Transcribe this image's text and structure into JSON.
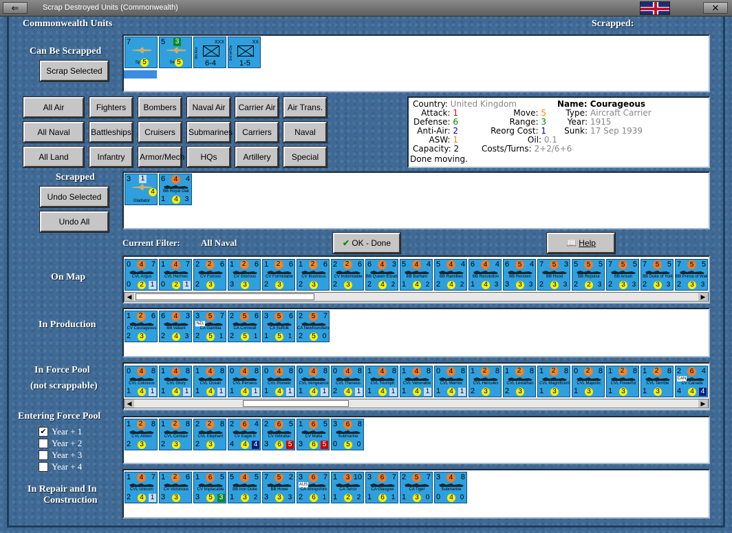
{
  "window": {
    "title": "Scrap Destroyed Units (Commonwealth)"
  },
  "header": {
    "left": "Commonwealth Units",
    "right": "Scrapped:"
  },
  "scrappable": {
    "label": "Can Be Scrapped",
    "button": "Scrap Selected",
    "units": [
      {
        "tl": "7",
        "tr": "",
        "br": "",
        "type": "plane",
        "name": "Spitfire",
        "yel": "5",
        "orange": "",
        "sq": "",
        "sqc": ""
      },
      {
        "tl": "5",
        "tr": "",
        "type": "plane",
        "name": "Seafire",
        "yel": "5",
        "bl": "",
        "badge": "3"
      },
      {
        "tl": "",
        "tr": "XXX",
        "type": "inf",
        "name": "6-4",
        "side": "6th Arm"
      },
      {
        "tl": "",
        "tr": "XX",
        "type": "inf",
        "name": "1-5",
        "side": "3rd Inf Div"
      }
    ]
  },
  "filters": {
    "row1": [
      "All Air",
      "Fighters",
      "Bombers",
      "Naval Air",
      "Carrier Air",
      "Air Trans."
    ],
    "row2": [
      "All Naval",
      "Battleships",
      "Cruisers",
      "Submarines",
      "Carriers",
      "Naval Trans."
    ],
    "row3": [
      "All Land",
      "Infantry",
      "Armor/Mech",
      "HQs",
      "Artillery",
      "Special"
    ]
  },
  "info": {
    "country_k": "Country:",
    "country_v": "United Kingdom",
    "attack_k": "Attack:",
    "attack_v": "1",
    "defense_k": "Defense:",
    "defense_v": "6",
    "antiair_k": "Anti-Air:",
    "antiair_v": "2",
    "asw_k": "ASW:",
    "asw_v": "1",
    "capacity_k": "Capacity:",
    "capacity_v": "2",
    "status": "Done moving.",
    "move_k": "Move:",
    "move_v": "5",
    "range_k": "Range:",
    "range_v": "3",
    "reorg_k": "Reorg Cost:",
    "reorg_v": "1",
    "oil_k": "Oil:",
    "oil_v": "0.1",
    "cost_k": "Costs/Turns:",
    "cost_v": "2+2/6+6",
    "name_k": "Name:",
    "name_v": "Courageous",
    "type_k": "Type:",
    "type_v": "Aircraft Carrier",
    "year_k": "Year:",
    "year_v": "1915",
    "sunk_k": "Sunk:",
    "sunk_v": "17 Sep 1939"
  },
  "scrapped": {
    "label": "Scrapped",
    "undo_selected": "Undo Selected",
    "undo_all": "Undo All",
    "units": [
      {
        "tl": "3",
        "tr": "",
        "badge": "1",
        "type": "plane",
        "name": "Gladiator",
        "yel": "4"
      },
      {
        "tl": "6",
        "tr": "4",
        "o": "4",
        "type": "ship",
        "name": "BB Royal Oak",
        "bl": "1",
        "yel": "4",
        "br": "3"
      }
    ]
  },
  "filter_bar": {
    "label": "Current Filter:",
    "value": "All Naval",
    "ok": "OK - Done",
    "help": "Help"
  },
  "sections": {
    "on_map": "On Map",
    "in_production": "In Production",
    "force_pool_1": "In Force Pool",
    "force_pool_2": "(not scrappable)",
    "entering": "Entering Force Pool",
    "repair_1": "In Repair and In",
    "repair_2": "Construction"
  },
  "years": [
    {
      "label": "Year + 1",
      "checked": true
    },
    {
      "label": "Year + 2",
      "checked": false
    },
    {
      "label": "Year + 3",
      "checked": false
    },
    {
      "label": "Year + 4",
      "checked": false
    }
  ],
  "on_map": [
    {
      "tl": "0",
      "o": "4",
      "tr": "7",
      "name": "CVL Argus",
      "bl": "0",
      "yel": "2",
      "sq": "1",
      "sqc": "b"
    },
    {
      "tl": "1",
      "o": "4",
      "tr": "7",
      "name": "CVL Hermes",
      "bl": "0",
      "yel": "2",
      "sq": "1",
      "sqc": "b"
    },
    {
      "tl": "2",
      "o": "5",
      "tr": "6",
      "name": "CV Furious",
      "bl": "2",
      "yel": "3",
      "sq": "2",
      "sqc": "o"
    },
    {
      "tl": "1",
      "o": "5",
      "tr": "6",
      "name": "CV Glorious",
      "bl": "3",
      "yel": "3",
      "sq": "2",
      "sqc": "o"
    },
    {
      "tl": "1",
      "o": "5",
      "tr": "6",
      "name": "CV Formidable",
      "bl": "2",
      "yel": "3",
      "sq": "2",
      "sqc": "o"
    },
    {
      "tl": "1",
      "o": "5",
      "tr": "6",
      "name": "CV Illustrious",
      "bl": "2",
      "yel": "3",
      "sq": "2",
      "sqc": "o"
    },
    {
      "tl": "2",
      "o": "5",
      "tr": "6",
      "name": "CV Indomitable",
      "bl": "2",
      "yel": "3",
      "sq": "2",
      "sqc": "o"
    },
    {
      "tl": "6",
      "o": "4",
      "tr": "3",
      "name": "BB Queen Elizabeth",
      "bl": "2",
      "yel": "4",
      "sq": "2",
      "sqc": ""
    },
    {
      "tl": "5",
      "o": "4",
      "tr": "4",
      "name": "BB Barham",
      "bl": "1",
      "yel": "4",
      "sq": "2",
      "sqc": ""
    },
    {
      "tl": "5",
      "o": "4",
      "tr": "4",
      "name": "BB Ramillies",
      "bl": "2",
      "yel": "4",
      "sq": "2",
      "sqc": ""
    },
    {
      "tl": "6",
      "o": "4",
      "tr": "4",
      "name": "BB Resolution",
      "bl": "1",
      "yel": "4",
      "sq": "3",
      "sqc": ""
    },
    {
      "tl": "6",
      "o": "5",
      "tr": "4",
      "name": "BB Renown",
      "bl": "3",
      "yel": "3",
      "sq": "3",
      "sqc": ""
    },
    {
      "tl": "7",
      "o": "5",
      "tr": "3",
      "name": "BB Hood",
      "bl": "2",
      "yel": "3",
      "sq": "3",
      "sqc": ""
    },
    {
      "tl": "5",
      "o": "5",
      "tr": "5",
      "name": "BB Repulse",
      "bl": "2",
      "yel": "2",
      "sq": "3",
      "sqc": ""
    },
    {
      "tl": "7",
      "o": "5",
      "tr": "5",
      "name": "BB Anson",
      "bl": "2",
      "yel": "3",
      "sq": "3",
      "sqc": ""
    },
    {
      "tl": "7",
      "o": "5",
      "tr": "5",
      "name": "BB Duke of York",
      "bl": "2",
      "yel": "3",
      "sq": "3",
      "sqc": ""
    },
    {
      "tl": "7",
      "o": "5",
      "tr": "5",
      "name": "BB Prince of Wales",
      "bl": "2",
      "yel": "3",
      "sq": "3",
      "sqc": ""
    }
  ],
  "in_production": [
    {
      "tl": "1",
      "o": "5",
      "tr": "6",
      "name": "CV Courageous",
      "bl": "2",
      "yel": "3",
      "sq": "2",
      "sqc": "o"
    },
    {
      "tl": "6",
      "o": "4",
      "tr": "3",
      "name": "BB Valiant",
      "bl": "2",
      "yel": "4",
      "sq": "3",
      "sqc": ""
    },
    {
      "tl": "3",
      "o": "5",
      "tr": "7",
      "name": "CA Gambia",
      "bl": "2",
      "yel": "5",
      "sq": "1",
      "sqc": "",
      "flag": "NZL"
    },
    {
      "tl": "2",
      "o": "5",
      "tr": "6",
      "name": "CA Cornwall",
      "bl": "2",
      "yel": "5",
      "sq": "1",
      "sqc": ""
    },
    {
      "tl": "3",
      "o": "5",
      "tr": "6",
      "name": "CA Suffolk",
      "bl": "1",
      "yel": "5",
      "sq": "1",
      "sqc": ""
    },
    {
      "tl": "2",
      "o": "5",
      "tr": "7",
      "name": "CA Newfoundland",
      "bl": "2",
      "yel": "5",
      "sq": "0",
      "sqc": ""
    }
  ],
  "force_pool": [
    {
      "tl": "0",
      "o": "4",
      "tr": "8",
      "name": "CVL Colossus",
      "bl": "1",
      "yel": "4",
      "sq": "1",
      "sqc": "b"
    },
    {
      "tl": "1",
      "o": "4",
      "tr": "8",
      "name": "CVL Glory",
      "bl": "1",
      "yel": "4",
      "sq": "1",
      "sqc": "b"
    },
    {
      "tl": "1",
      "o": "4",
      "tr": "8",
      "name": "CVL Ocean",
      "bl": "1",
      "yel": "4",
      "sq": "1",
      "sqc": "b"
    },
    {
      "tl": "0",
      "o": "4",
      "tr": "8",
      "name": "CVL Perseus",
      "bl": "1",
      "yel": "4",
      "sq": "1",
      "sqc": "b"
    },
    {
      "tl": "0",
      "o": "4",
      "tr": "8",
      "name": "CVL Pioneer",
      "bl": "1",
      "yel": "4",
      "sq": "1",
      "sqc": "b"
    },
    {
      "tl": "0",
      "o": "4",
      "tr": "8",
      "name": "CVL Vengeance",
      "bl": "1",
      "yel": "4",
      "sq": "1",
      "sqc": "b"
    },
    {
      "tl": "0",
      "o": "4",
      "tr": "8",
      "name": "CVL Theseus",
      "bl": "2",
      "yel": "4",
      "sq": "1",
      "sqc": "b"
    },
    {
      "tl": "1",
      "o": "4",
      "tr": "8",
      "name": "CVL Triumph",
      "bl": "1",
      "yel": "4",
      "sq": "1",
      "sqc": "b"
    },
    {
      "tl": "1",
      "o": "4",
      "tr": "8",
      "name": "CVL Venerable",
      "bl": "1",
      "yel": "4",
      "sq": "1",
      "sqc": "b"
    },
    {
      "tl": "0",
      "o": "4",
      "tr": "8",
      "name": "CVL Warrior",
      "bl": "1",
      "yel": "4",
      "sq": "1",
      "sqc": "b"
    },
    {
      "tl": "1",
      "o": "4",
      "tr": "8",
      "name": "CVL Hercules",
      "bl": "2",
      "yel": "3",
      "sq": "2",
      "sqc": "o"
    },
    {
      "tl": "1",
      "o": "4",
      "tr": "8",
      "name": "CVL Leviathan",
      "bl": "2",
      "yel": "3",
      "sq": "2",
      "sqc": "o"
    },
    {
      "tl": "1",
      "o": "4",
      "tr": "8",
      "name": "CVL Magnificent",
      "bl": "1",
      "yel": "3",
      "sq": "2",
      "sqc": "o"
    },
    {
      "tl": "0",
      "o": "4",
      "tr": "8",
      "name": "CVL Majestic",
      "bl": "1",
      "yel": "3",
      "sq": "2",
      "sqc": "o"
    },
    {
      "tl": "1",
      "o": "4",
      "tr": "8",
      "name": "CVL Powerful",
      "bl": "1",
      "yel": "3",
      "sq": "2",
      "sqc": "o"
    },
    {
      "tl": "1",
      "o": "4",
      "tr": "8",
      "name": "CVL Terrible",
      "bl": "1",
      "yel": "3",
      "sq": "2",
      "sqc": "o"
    },
    {
      "tl": "2",
      "o": "6",
      "tr": "4",
      "name": "CV Canada",
      "bl": "4",
      "yel": "4",
      "sq": "4",
      "sqc": "k",
      "flag": "CAN"
    }
  ],
  "entering": [
    {
      "tl": "1",
      "o": "5",
      "tr": "8",
      "name": "CVL Albion",
      "bl": "2",
      "yel": "3",
      "sq": "2",
      "sqc": "o"
    },
    {
      "tl": "1",
      "o": "5",
      "tr": "8",
      "name": "CVL Centaur",
      "bl": "2",
      "yel": "3",
      "sq": "2",
      "sqc": "o"
    },
    {
      "tl": "2",
      "o": "5",
      "tr": "8",
      "name": "CVL Elephant",
      "bl": "2",
      "yel": "3",
      "sq": "2",
      "sqc": "o"
    },
    {
      "tl": "2",
      "o": "6",
      "tr": "4",
      "name": "CV Eagle II",
      "bl": "4",
      "yel": "4",
      "sq": "4",
      "sqc": "k"
    },
    {
      "tl": "2",
      "o": "6",
      "tr": "5",
      "name": "CV Gibraltar",
      "bl": "3",
      "yel": "6",
      "sq": "5",
      "sqc": "r"
    },
    {
      "tl": "1",
      "o": "6",
      "tr": "5",
      "name": "CV Malta",
      "bl": "3",
      "yel": "6",
      "sq": "5",
      "sqc": "r"
    },
    {
      "tl": "3",
      "o": "6",
      "tr": "8",
      "name": "Submarine",
      "bl": "0",
      "yel": "5",
      "sq": "0",
      "sqc": ""
    }
  ],
  "repair": [
    {
      "tl": "1",
      "o": "4",
      "tr": "7",
      "name": "CVL Unicorn",
      "bl": "2",
      "yel": "4",
      "sq": "1",
      "sqc": "b"
    },
    {
      "tl": "1",
      "o": "5",
      "tr": "6",
      "name": "CV Victorious",
      "bl": "3",
      "yel": "3",
      "sq": "2",
      "sqc": "o"
    },
    {
      "tl": "1",
      "o": "6",
      "tr": "5",
      "name": "CV Implacable",
      "bl": "3",
      "yel": "5",
      "sq": "3",
      "sqc": "g"
    },
    {
      "tl": "5",
      "o": "4",
      "tr": "5",
      "name": "BB Iron Duke",
      "bl": "1",
      "yel": "3",
      "sq": "2",
      "sqc": ""
    },
    {
      "tl": "7",
      "o": "5",
      "tr": "2",
      "name": "BB Howe",
      "bl": "3",
      "yel": "3",
      "sq": "3",
      "sqc": ""
    },
    {
      "tl": "3",
      "o": "6",
      "tr": "7",
      "name": "CA Shropshire",
      "bl": "2",
      "yel": "6",
      "sq": "1",
      "sqc": "",
      "flag": "AUS"
    },
    {
      "tl": "1",
      "o": "3",
      "tr": "10",
      "name": "CA Terror",
      "bl": "1",
      "yel": "2",
      "sq": "2",
      "sqc": ""
    },
    {
      "tl": "3",
      "o": "6",
      "tr": "7",
      "name": "CA Glasgow",
      "bl": "1",
      "yel": "6",
      "sq": "1",
      "sqc": ""
    },
    {
      "tl": "2",
      "o": "5",
      "tr": "7",
      "name": "CA Tiger",
      "bl": "1",
      "yel": "3",
      "sq": "0",
      "sqc": ""
    },
    {
      "tl": "3",
      "o": "4",
      "tr": "8",
      "name": "Submarine",
      "bl": "0",
      "yel": "4",
      "sq": "0",
      "sqc": ""
    }
  ],
  "colors": {
    "background": "#3f6a96",
    "counter": "#2fa0dd"
  }
}
